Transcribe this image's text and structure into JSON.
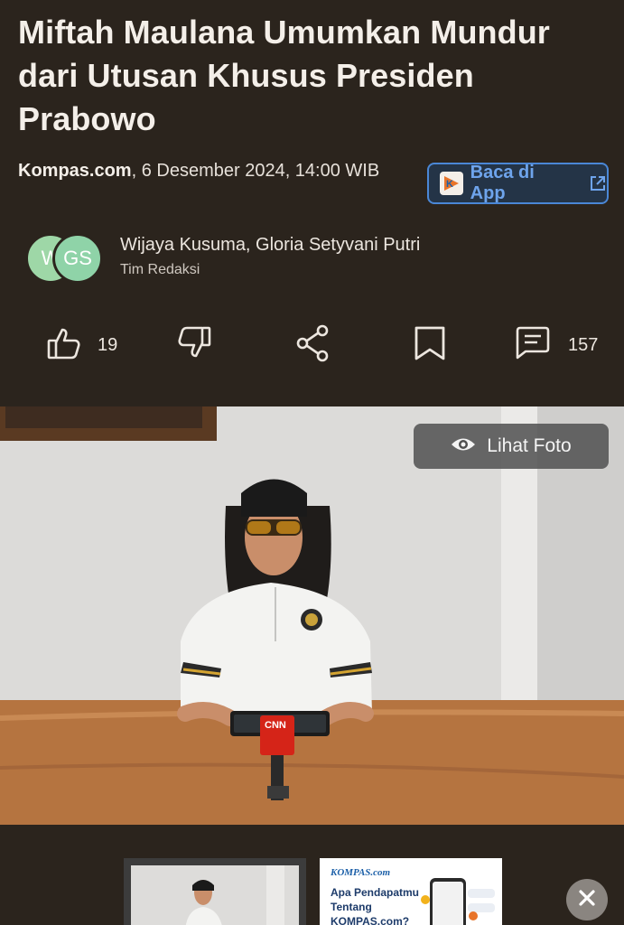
{
  "article": {
    "title": "Miftah Maulana Umumkan Mundur dari Utusan Khusus Presiden Prabowo",
    "source": "Kompas.com",
    "date_line": ", 6 Desember 2024, 14:00 WIB"
  },
  "app_button": {
    "label": "Baca di App",
    "icon_letter": "K"
  },
  "authors": {
    "avatars": [
      "W",
      "GS"
    ],
    "names": "Wijaya Kusuma, Gloria Setyvani Putri",
    "team": "Tim Redaksi"
  },
  "actions": {
    "like_count": "19",
    "comment_count": "157"
  },
  "photo": {
    "view_button_label": "Lihat Foto",
    "mic_label": "CNN"
  },
  "ad": {
    "brand": "KOMPAS.com",
    "question": "Apa Pendapatmu Tentang KOMPAS.com?"
  },
  "colors": {
    "background": "#2b241d",
    "accent_blue": "#4a87d6",
    "avatar_green": "#9ed7a7"
  },
  "icons": [
    "thumbs-up-icon",
    "thumbs-down-icon",
    "share-icon",
    "bookmark-icon",
    "comment-icon",
    "eye-icon",
    "external-link-icon",
    "close-icon"
  ]
}
